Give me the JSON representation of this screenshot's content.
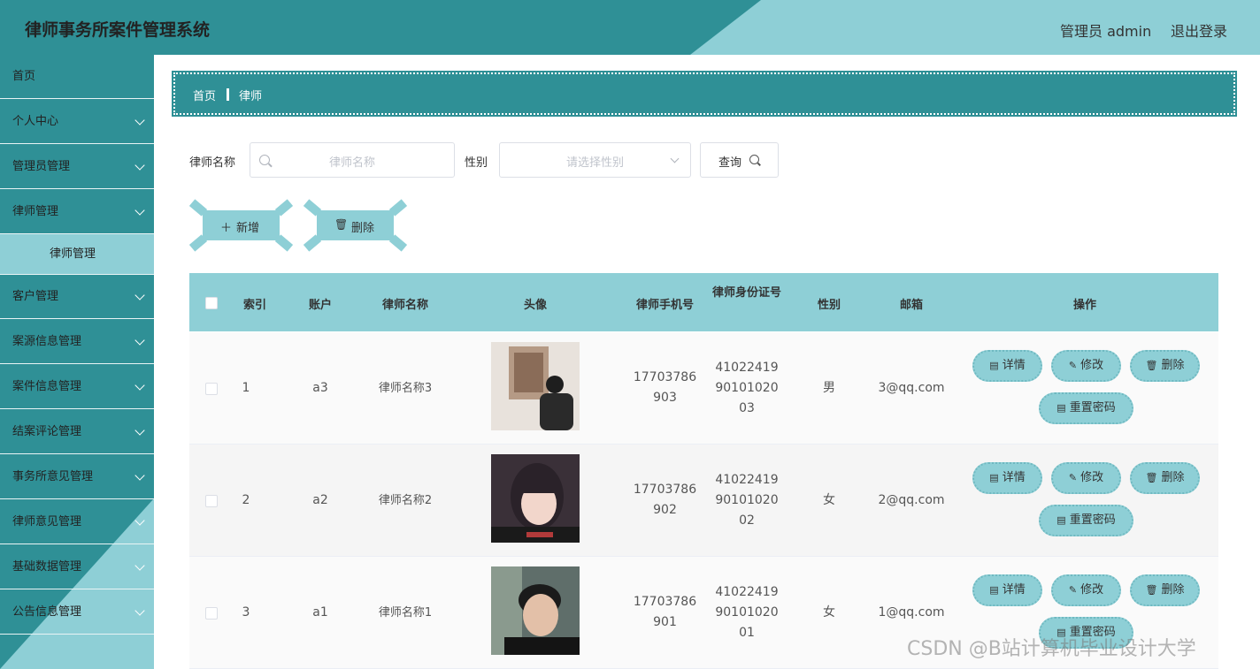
{
  "header": {
    "title": "律师事务所案件管理系统",
    "user": "管理员 admin",
    "logout": "退出登录"
  },
  "sidebar": {
    "items": [
      {
        "label": "首页",
        "expandable": false
      },
      {
        "label": "个人中心",
        "expandable": true
      },
      {
        "label": "管理员管理",
        "expandable": true
      },
      {
        "label": "律师管理",
        "expandable": true
      },
      {
        "label": "律师管理",
        "sub": true
      },
      {
        "label": "客户管理",
        "expandable": true
      },
      {
        "label": "案源信息管理",
        "expandable": true
      },
      {
        "label": "案件信息管理",
        "expandable": true
      },
      {
        "label": "结案评论管理",
        "expandable": true
      },
      {
        "label": "事务所意见管理",
        "expandable": true
      },
      {
        "label": "律师意见管理",
        "expandable": true
      },
      {
        "label": "基础数据管理",
        "expandable": true
      },
      {
        "label": "公告信息管理",
        "expandable": true
      }
    ]
  },
  "breadcrumb": {
    "home": "首页",
    "current": "律师"
  },
  "search": {
    "name_label": "律师名称",
    "name_placeholder": "律师名称",
    "gender_label": "性别",
    "gender_placeholder": "请选择性别",
    "query_label": "查询"
  },
  "actions": {
    "add": "新增",
    "delete": "删除"
  },
  "table": {
    "headers": [
      "索引",
      "账户",
      "律师名称",
      "头像",
      "律师手机号",
      "律师身份证号",
      "性别",
      "邮箱",
      "操作"
    ],
    "rows": [
      {
        "index": "1",
        "account": "a3",
        "name": "律师名称3",
        "phone1": "17703786",
        "phone2": "903",
        "id1": "41022419",
        "id2": "90101020",
        "id3": "03",
        "gender": "男",
        "email": "3@qq.com",
        "avatar": "avatar-photo-1"
      },
      {
        "index": "2",
        "account": "a2",
        "name": "律师名称2",
        "phone1": "17703786",
        "phone2": "902",
        "id1": "41022419",
        "id2": "90101020",
        "id3": "02",
        "gender": "女",
        "email": "2@qq.com",
        "avatar": "avatar-photo-2"
      },
      {
        "index": "3",
        "account": "a1",
        "name": "律师名称1",
        "phone1": "17703786",
        "phone2": "901",
        "id1": "41022419",
        "id2": "90101020",
        "id3": "01",
        "gender": "女",
        "email": "1@qq.com",
        "avatar": "avatar-photo-3"
      }
    ],
    "ops": {
      "detail": "详情",
      "edit": "修改",
      "delete": "删除",
      "reset": "重置密码"
    }
  },
  "watermark": "CSDN @B站计算机毕业设计大学"
}
